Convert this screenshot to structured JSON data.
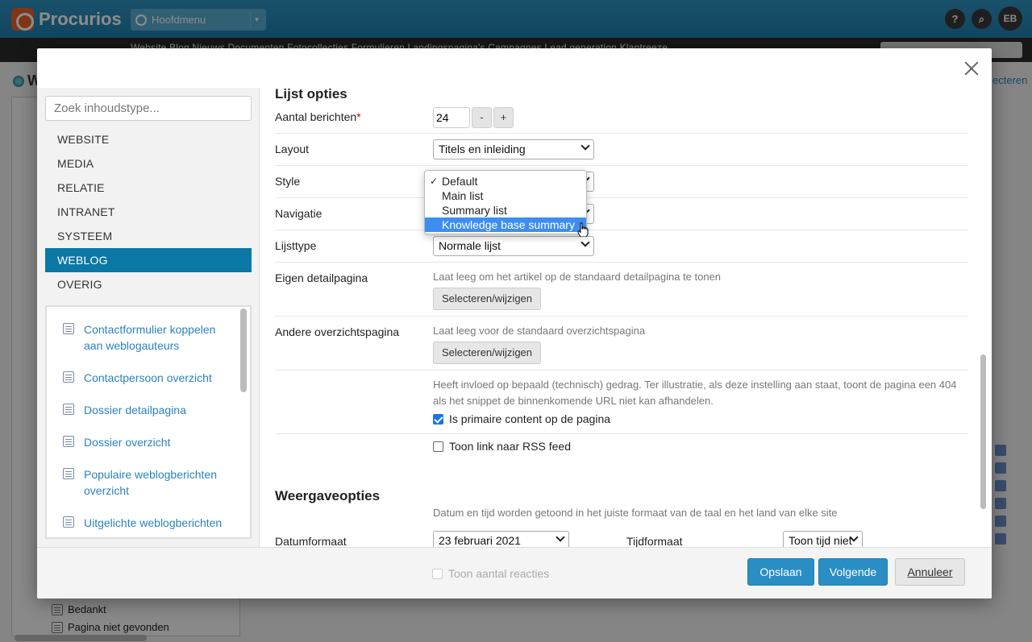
{
  "app": {
    "logo_text": "Procurios",
    "main_menu_label": "Hoofdmenu",
    "nav_strip_text": "Website   Blog   Nieuws   Documenten   Fotocollecties   Formulieren   Landingspagina's   Campagnes   Lead generation   Klantreeze",
    "help_label": "?",
    "user_initials": "EB",
    "page_letter": "W",
    "right_link": "ecteren",
    "tree_items": [
      "Bedankt",
      "Pagina niet gevonden"
    ]
  },
  "dialog": {
    "search_placeholder": "Zoek inhoudstype...",
    "categories": [
      "WEBSITE",
      "MEDIA",
      "RELATIE",
      "INTRANET",
      "SYSTEEM",
      "WEBLOG",
      "OVERIG"
    ],
    "active_category": "WEBLOG",
    "content_types": [
      "Contactformulier koppelen aan weblogauteurs",
      "Contactpersoon overzicht",
      "Dossier detailpagina",
      "Dossier overzicht",
      "Populaire weblogberichten overzicht",
      "Uitgelichte weblogberichten"
    ]
  },
  "form": {
    "list_options_title": "Lijst opties",
    "aantal_label": "Aantal berichten",
    "aantal_value": "24",
    "minus": "-",
    "plus": "+",
    "layout_label": "Layout",
    "layout_value": "Titels en inleiding",
    "style_label": "Style",
    "style_options": [
      "Default",
      "Main list",
      "Summary list",
      "Knowledge base summary"
    ],
    "style_selected": "Default",
    "style_highlighted": "Knowledge base summary",
    "navigatie_label": "Navigatie",
    "lijsttype_label": "Lijsttype",
    "lijsttype_value": "Normale lijst",
    "eigen_label": "Eigen detailpagina",
    "eigen_help": "Laat leeg om het artikel op de standaard detailpagina te tonen",
    "select_change": "Selecteren/wijzigen",
    "andere_label": "Andere overzichtspagina",
    "andere_help": "Laat leeg voor de standaard overzichtspagina",
    "primary_help_line1": "Heeft invloed op bepaald (technisch) gedrag. Ter illustratie, als deze instelling aan staat, toont de pagina een 404",
    "primary_help_line2": "als het snippet de binnenkomende URL niet kan afhandelen.",
    "primary_label": "Is primaire content op de pagina",
    "primary_checked": true,
    "rss_label": "Toon link naar RSS feed",
    "rss_checked": false,
    "display_title": "Weergaveopties",
    "display_help": "Datum en tijd worden getoond in het juiste formaat van de taal en het land van elke site",
    "datum_label": "Datumformaat",
    "datum_value": "23 februari 2021",
    "tijd_label": "Tijdformaat",
    "tijd_value": "Toon tijd niet"
  },
  "footer": {
    "faded_label": "Toon aantal reacties",
    "save": "Opslaan",
    "next": "Volgende",
    "cancel": "Annuleer"
  },
  "colors": {
    "accent": "#0b78a5",
    "primary_button": "#2a8ec4",
    "header": "#1f7fb0",
    "highlight": "#3d8ef0"
  }
}
